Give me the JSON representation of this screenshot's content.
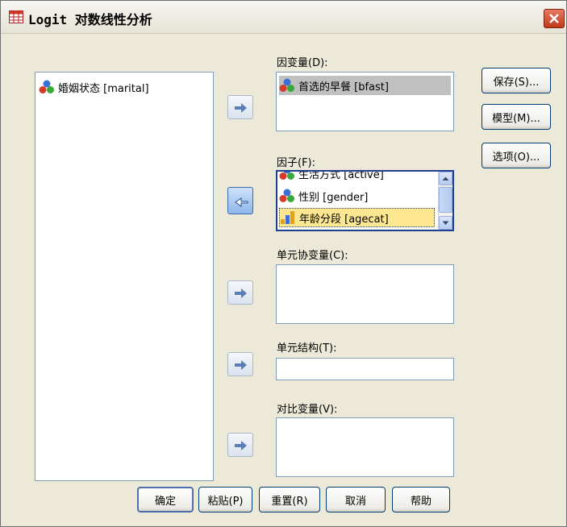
{
  "window": {
    "title": "Logit 对数线性分析",
    "close_icon": "close-icon"
  },
  "source_list": {
    "items": [
      {
        "label": "婚姻状态 [marital]",
        "icon": "nominal-variable-icon"
      }
    ]
  },
  "dependent": {
    "label": "因变量(D):",
    "items": [
      {
        "label": "首选的早餐 [bfast]",
        "icon": "nominal-variable-icon",
        "selected": true
      }
    ]
  },
  "factors": {
    "label": "因子(F):",
    "items": [
      {
        "label": "生活方式 [active]",
        "icon": "nominal-variable-icon"
      },
      {
        "label": "性别 [gender]",
        "icon": "nominal-variable-icon"
      },
      {
        "label": "年龄分段 [agecat]",
        "icon": "ordinal-variable-icon",
        "focused": true
      }
    ]
  },
  "cell_covariates": {
    "label": "单元协变量(C):",
    "items": []
  },
  "cell_structure": {
    "label": "单元结构(T):",
    "value": ""
  },
  "contrast": {
    "label": "对比变量(V):",
    "items": []
  },
  "side_buttons": {
    "save": "保存(S)...",
    "model": "模型(M)...",
    "options": "选项(O)..."
  },
  "bottom_buttons": {
    "ok": "确定",
    "paste": "粘贴(P)",
    "reset": "重置(R)",
    "cancel": "取消",
    "help": "帮助"
  },
  "colors": {
    "accent": "#316ac5",
    "window_bg": "#ece9d8",
    "selection": "#c0c0c0",
    "focus_highlight": "#fde790"
  }
}
